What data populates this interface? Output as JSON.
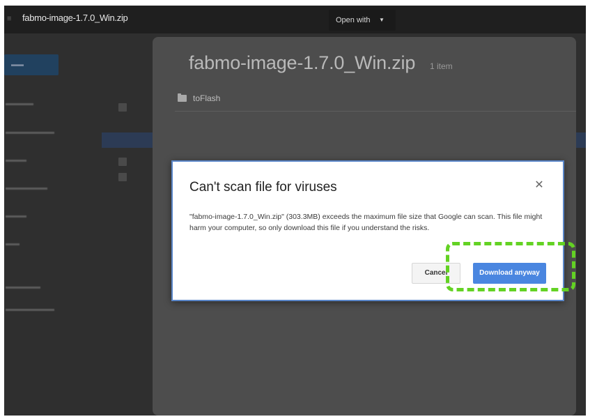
{
  "topbar": {
    "file_title": "fabmo-image-1.7.0_Win.zip",
    "open_with_label": "Open with"
  },
  "zip_preview": {
    "title": "fabmo-image-1.7.0_Win.zip",
    "item_count": "1 item",
    "items": [
      {
        "name": "toFlash"
      }
    ]
  },
  "dialog": {
    "title": "Can't scan file for viruses",
    "message": "\"fabmo-image-1.7.0_Win.zip\" (303.3MB) exceeds the maximum file size that Google can scan. This file might harm your computer, so only download this file if you understand the risks.",
    "cancel_label": "Cancel",
    "download_label": "Download anyway"
  },
  "colors": {
    "primary_button": "#4a86e0",
    "highlight": "#63d223",
    "overlay": "#2f2f2f"
  },
  "icons": [
    "menu-icon",
    "caret-down-icon",
    "folder-icon",
    "close-icon"
  ]
}
